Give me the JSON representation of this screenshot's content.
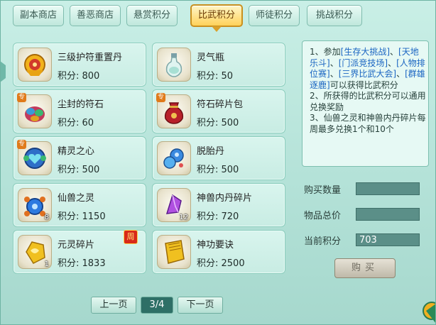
{
  "tabs": [
    {
      "label": "副本商店",
      "active": false
    },
    {
      "label": "善恶商店",
      "active": false
    },
    {
      "label": "悬赏积分",
      "active": false
    },
    {
      "label": "比武积分",
      "active": true
    },
    {
      "label": "师徒积分",
      "active": false
    },
    {
      "label": "挑战积分",
      "active": false
    }
  ],
  "items": [
    {
      "name": "三级护符重置丹",
      "price": "积分: 800",
      "icon": "golden-charm-icon"
    },
    {
      "name": "灵气瓶",
      "price": "积分: 50",
      "icon": "spirit-bottle-icon"
    },
    {
      "name": "尘封的符石",
      "price": "积分: 60",
      "icon": "sealed-rune-stone-icon",
      "badge": "专"
    },
    {
      "name": "符石碎片包",
      "price": "积分: 500",
      "icon": "rune-fragment-bag-icon",
      "badge": "专"
    },
    {
      "name": "精灵之心",
      "price": "积分: 500",
      "icon": "elf-heart-icon",
      "badge": "专"
    },
    {
      "name": "脱胎丹",
      "price": "积分: 500",
      "icon": "rebirth-pill-icon"
    },
    {
      "name": "仙兽之灵",
      "price": "积分: 1150",
      "icon": "beast-spirit-icon",
      "count": "8"
    },
    {
      "name": "神兽内丹碎片",
      "price": "积分: 720",
      "icon": "beast-core-fragment-icon",
      "count": "12"
    },
    {
      "name": "元灵碎片",
      "price": "积分: 1833",
      "icon": "yuanling-fragment-icon",
      "count": "1"
    },
    {
      "name": "神功要诀",
      "price": "积分: 2500",
      "icon": "skill-manual-icon"
    }
  ],
  "weekly_badge": "周",
  "pager": {
    "prev": "上一页",
    "page": "3/4",
    "next": "下一页"
  },
  "info": {
    "p1_a": "1、参加",
    "h1": "[生存大挑战]",
    "sep1": "、",
    "h2": "[天地乐斗]",
    "sep2": "、",
    "h3": "[门派竞技场]",
    "sep3": "、",
    "h4": "[人物排位赛]",
    "sep4": "、",
    "h5": "[三界比武大会]",
    "sep5": "、",
    "h6": "[群雄逐鹿]",
    "p1_b": "可以获得比武积分",
    "p2": "2、所获得的比武积分可以通用兑换奖励",
    "p3": "3、仙兽之灵和神兽内丹碎片每周最多兑换1个和10个"
  },
  "form": {
    "qty_label": "购买数量",
    "qty_value": "",
    "total_label": "物品总价",
    "total_value": "",
    "current_label": "当前积分",
    "current_value": "703"
  },
  "buy_button": "购买",
  "colors": {
    "background": "#b4e2d8",
    "active_tab": "#ffd25a",
    "highlight_text": "#1a65c2",
    "field_bg": "#5b8f88"
  }
}
